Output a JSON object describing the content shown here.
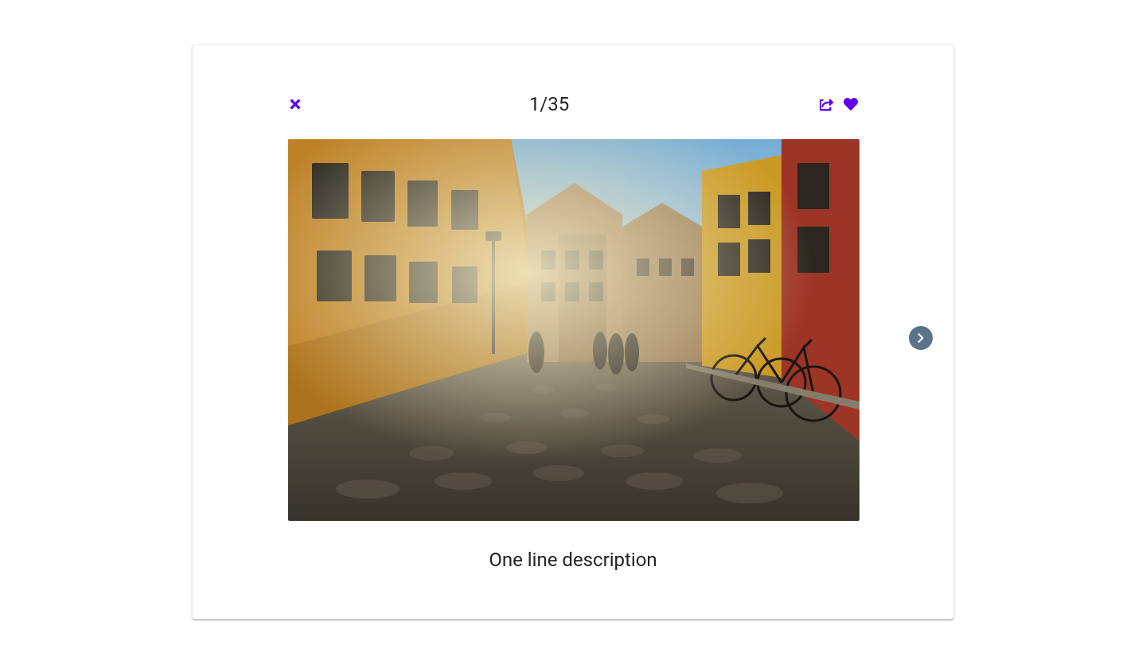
{
  "gallery": {
    "counter": "1/35",
    "caption": "One line description",
    "icons": {
      "close": "close-icon",
      "share": "share-icon",
      "favorite": "heart-icon",
      "next": "chevron-right-icon"
    },
    "colors": {
      "accent": "#6200ee",
      "nav": "#5a7389"
    }
  }
}
